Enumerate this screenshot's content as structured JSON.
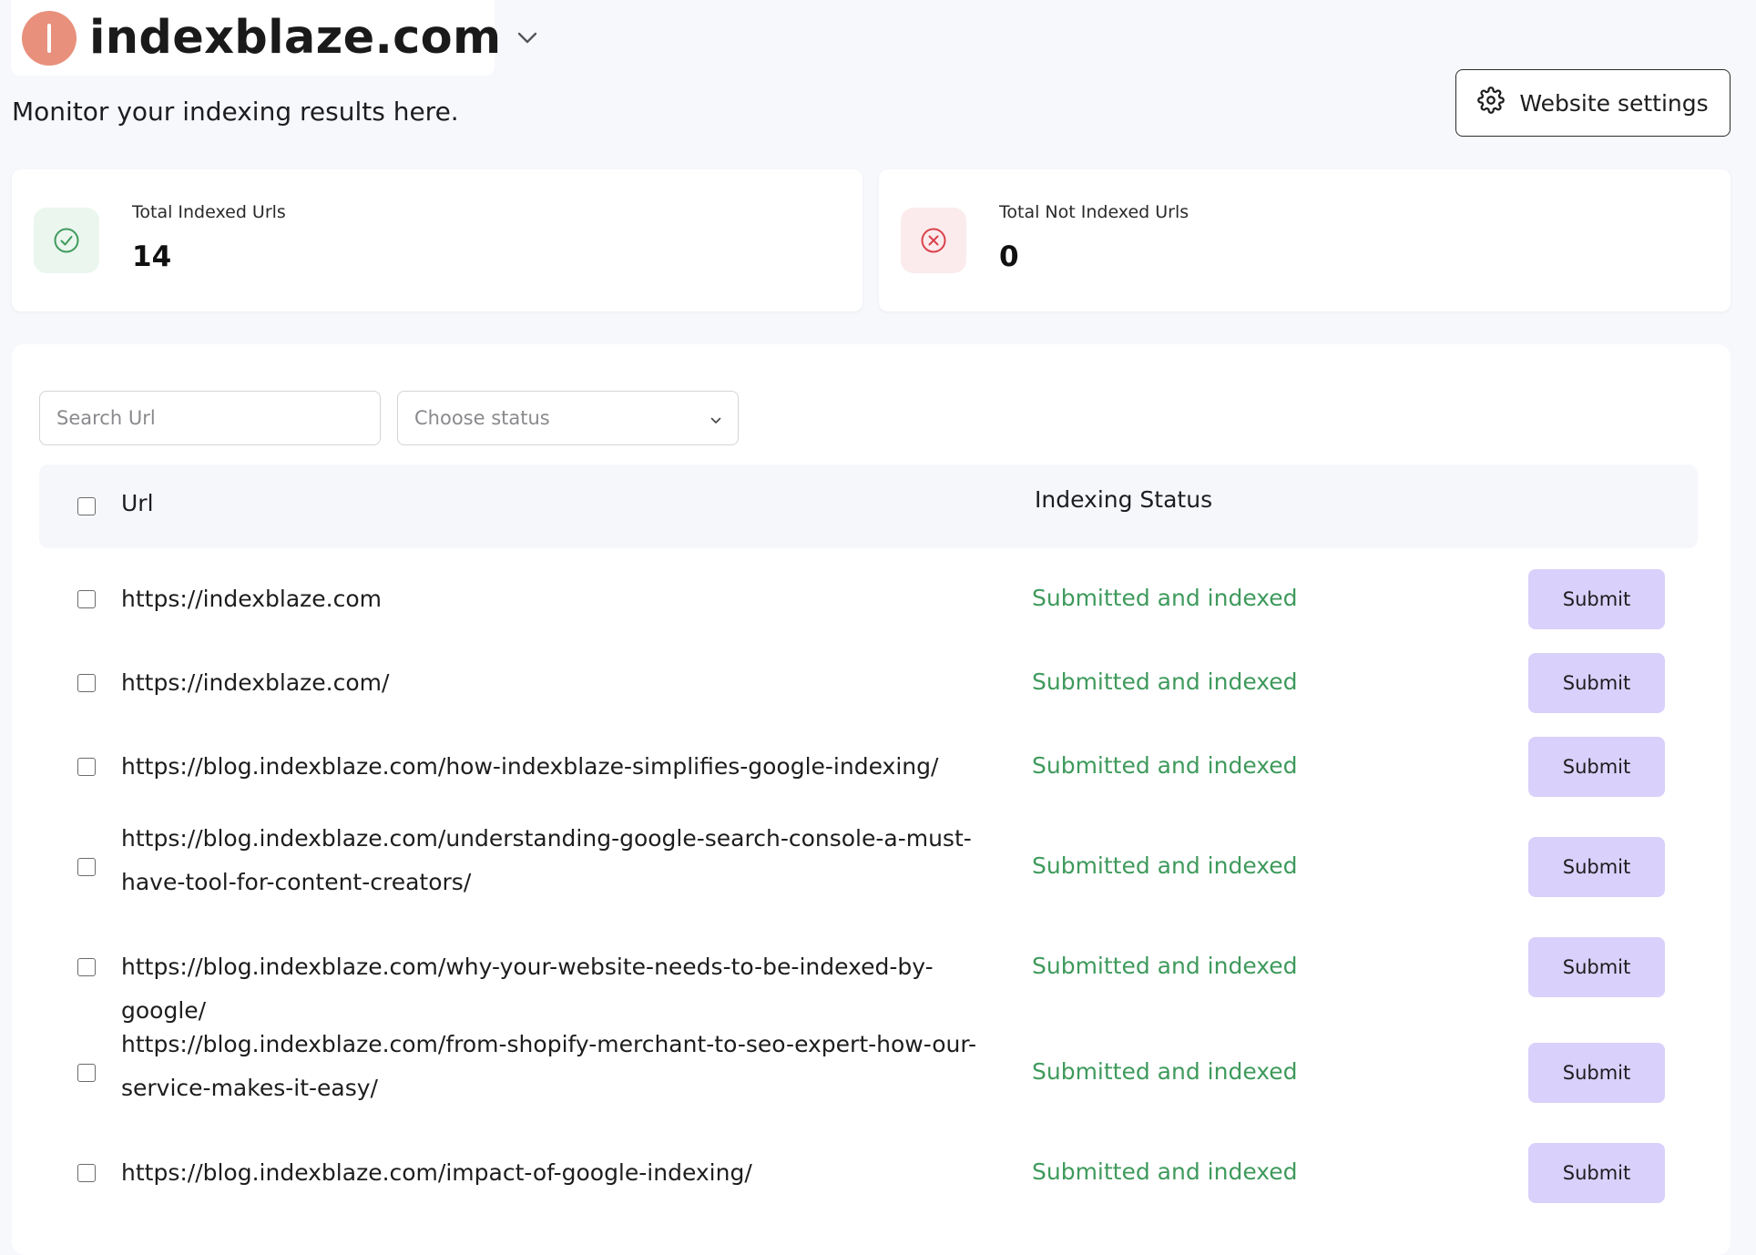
{
  "site": {
    "name": "indexblaze.com",
    "avatar_color": "#e8907c"
  },
  "subtitle": "Monitor your indexing results here.",
  "settings_button": {
    "label": "Website settings",
    "icon": "gear-icon"
  },
  "stats": {
    "indexed": {
      "label": "Total Indexed Urls",
      "value": "14",
      "icon": "check-circle-icon",
      "color": "#3f9a5c"
    },
    "not_indexed": {
      "label": "Total Not Indexed Urls",
      "value": "0",
      "icon": "x-circle-icon",
      "color": "#d9414b"
    }
  },
  "filters": {
    "search_placeholder": "Search Url",
    "status_placeholder": "Choose status"
  },
  "table": {
    "columns": {
      "url": "Url",
      "status": "Indexing Status"
    },
    "rows": [
      {
        "url": "https://indexblaze.com",
        "status": "Submitted and indexed",
        "action": "Submit"
      },
      {
        "url": "https://indexblaze.com/",
        "status": "Submitted and indexed",
        "action": "Submit"
      },
      {
        "url": "https://blog.indexblaze.com/how-indexblaze-simplifies-google-indexing/",
        "status": "Submitted and indexed",
        "action": "Submit"
      },
      {
        "url": "https://blog.indexblaze.com/understanding-google-search-console-a-must-have-tool-for-content-creators/",
        "url_line1": "https://blog.indexblaze.com/understanding-google-search-console-a-must-",
        "url_line2": "have-tool-for-content-creators/",
        "status": "Submitted and indexed",
        "action": "Submit"
      },
      {
        "url": "https://blog.indexblaze.com/why-your-website-needs-to-be-indexed-by-google/",
        "status": "Submitted and indexed",
        "action": "Submit"
      },
      {
        "url": "https://blog.indexblaze.com/from-shopify-merchant-to-seo-expert-how-our-service-makes-it-easy/",
        "url_line1": "https://blog.indexblaze.com/from-shopify-merchant-to-seo-expert-how-our-",
        "url_line2": "service-makes-it-easy/",
        "status": "Submitted and indexed",
        "action": "Submit"
      },
      {
        "url": "https://blog.indexblaze.com/impact-of-google-indexing/",
        "status": "Submitted and indexed",
        "action": "Submit"
      }
    ]
  },
  "colors": {
    "page_bg": "#f7f8fc",
    "status_green": "#3f9a5c",
    "submit_bg": "#d9d0fb"
  }
}
